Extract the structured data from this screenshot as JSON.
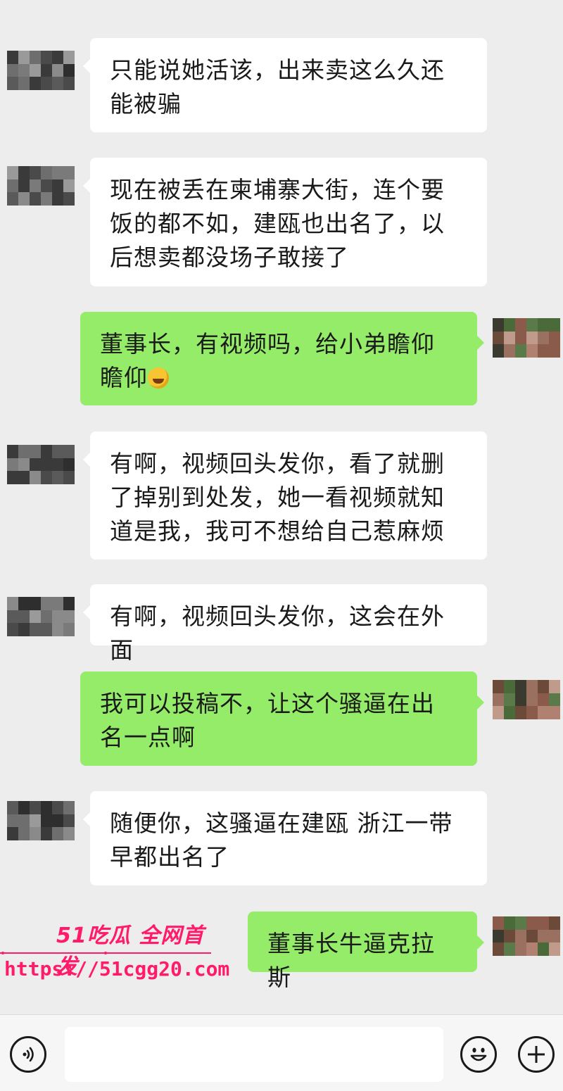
{
  "messages": [
    {
      "side": "left",
      "text": "只能说她活该，出来卖这么久还能被骗"
    },
    {
      "side": "left",
      "text": "现在被丢在柬埔寨大街，连个要饭的都不如，建瓯也出名了，以后想卖都没场子敢接了"
    },
    {
      "side": "right",
      "text": "董事长，有视频吗，给小弟瞻仰瞻仰",
      "emoji": "rolling-on-floor-laughing"
    },
    {
      "side": "left",
      "text": "有啊，视频回头发你，看了就删了掉别到处发，她一看视频就知道是我，我可不想给自己惹麻烦"
    },
    {
      "side": "left",
      "text": "有啊，视频回头发你，这会在外面"
    },
    {
      "side": "right",
      "text": "我可以投稿不，让这个骚逼在出名一点啊"
    },
    {
      "side": "left",
      "text": "随便你，这骚逼在建瓯 浙江一带早都出名了"
    },
    {
      "side": "right",
      "text": "董事长牛逼克拉斯"
    }
  ],
  "watermark": {
    "brand": "51吃瓜 全网首发",
    "url": "https://51cgg20.com"
  },
  "input_bar": {
    "voice_icon": "voice-icon",
    "emoji_icon": "emoji-icon",
    "plus_icon": "plus-icon",
    "text_value": ""
  },
  "colors": {
    "background": "#ededed",
    "bubble_self": "#95ec69",
    "bubble_other": "#ffffff",
    "watermark": "#ff1a6a"
  }
}
